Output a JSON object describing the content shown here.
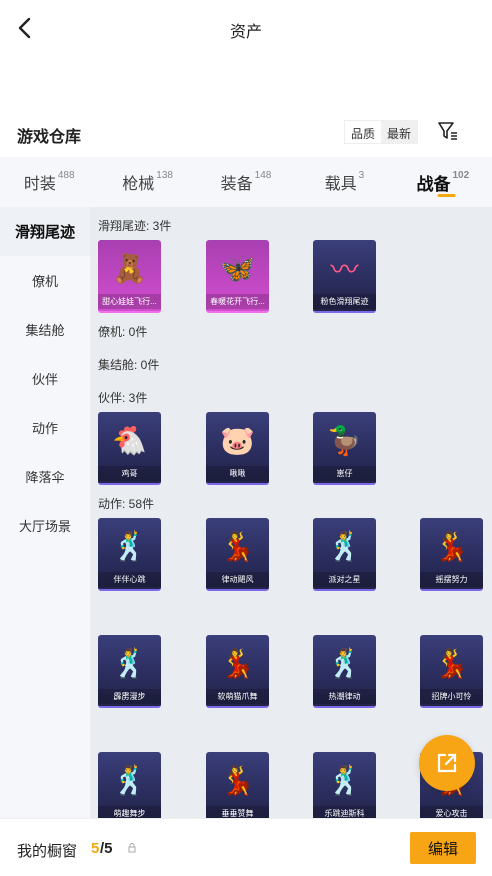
{
  "header": {
    "title": "资产"
  },
  "warehouse": {
    "title": "游戏仓库",
    "sort_options": [
      "品质",
      "最新"
    ]
  },
  "tabs": [
    {
      "label": "时装",
      "count": "488"
    },
    {
      "label": "枪械",
      "count": "138"
    },
    {
      "label": "装备",
      "count": "148"
    },
    {
      "label": "载具",
      "count": "3"
    },
    {
      "label": "战备",
      "count": "102"
    }
  ],
  "sidebar": {
    "items": [
      {
        "label": "滑翔尾迹"
      },
      {
        "label": "僚机"
      },
      {
        "label": "集结舱"
      },
      {
        "label": "伙伴"
      },
      {
        "label": "动作"
      },
      {
        "label": "降落伞"
      },
      {
        "label": "大厅场景"
      }
    ]
  },
  "groups": {
    "trails": {
      "label": "滑翔尾迹: 3件",
      "items": [
        "甜心娃娃飞行...",
        "春暖花开飞行...",
        "粉色滑翔尾迹"
      ]
    },
    "wingman": {
      "label": "僚机: 0件"
    },
    "capsule": {
      "label": "集结舱: 0件"
    },
    "partners": {
      "label": "伙伴: 3件",
      "items": [
        "鸡哥",
        "啾啾",
        "崽仔"
      ]
    },
    "emotes": {
      "label": "动作: 58件",
      "items": [
        "伴伴心跳",
        "律动飓风",
        "派对之星",
        "摇摆努力",
        "霹雳漫步",
        "软萌猫爪舞",
        "热潮律动",
        "招牌小可怜",
        "萌趣舞步",
        "垂垂赞舞",
        "乐跳迪斯科",
        "爱心攻击"
      ]
    }
  },
  "bottom": {
    "window_label": "我的橱窗",
    "count": "5",
    "total": "/5",
    "edit_label": "编辑"
  },
  "colors": {
    "accent": "#f7a515"
  }
}
